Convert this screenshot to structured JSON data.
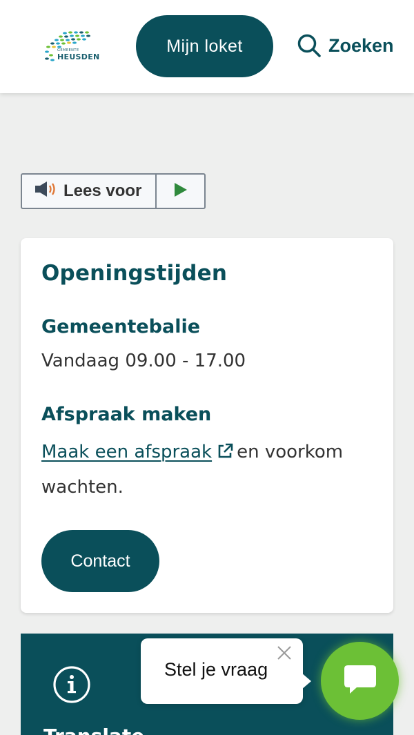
{
  "header": {
    "logo_sub": "GEMEENTE",
    "logo_name": "HEUSDEN",
    "login_label": "Mijn loket",
    "search_label": "Zoeken"
  },
  "read_aloud": {
    "label": "Lees voor"
  },
  "card": {
    "title": "Openingstijden",
    "desk_heading": "Gemeentebalie",
    "desk_hours": "Vandaag 09.00 - 17.00",
    "appointment_heading": "Afspraak maken",
    "appointment_link": "Maak een afspraak",
    "appointment_text": "en voorkom wachten.",
    "contact_label": "Contact"
  },
  "translate": {
    "title": "Translate"
  },
  "chat": {
    "prompt": "Stel je vraag"
  },
  "colors": {
    "brand": "#0a4f5a",
    "chat_green": "#6cc036",
    "page_bg": "#eeefee"
  }
}
